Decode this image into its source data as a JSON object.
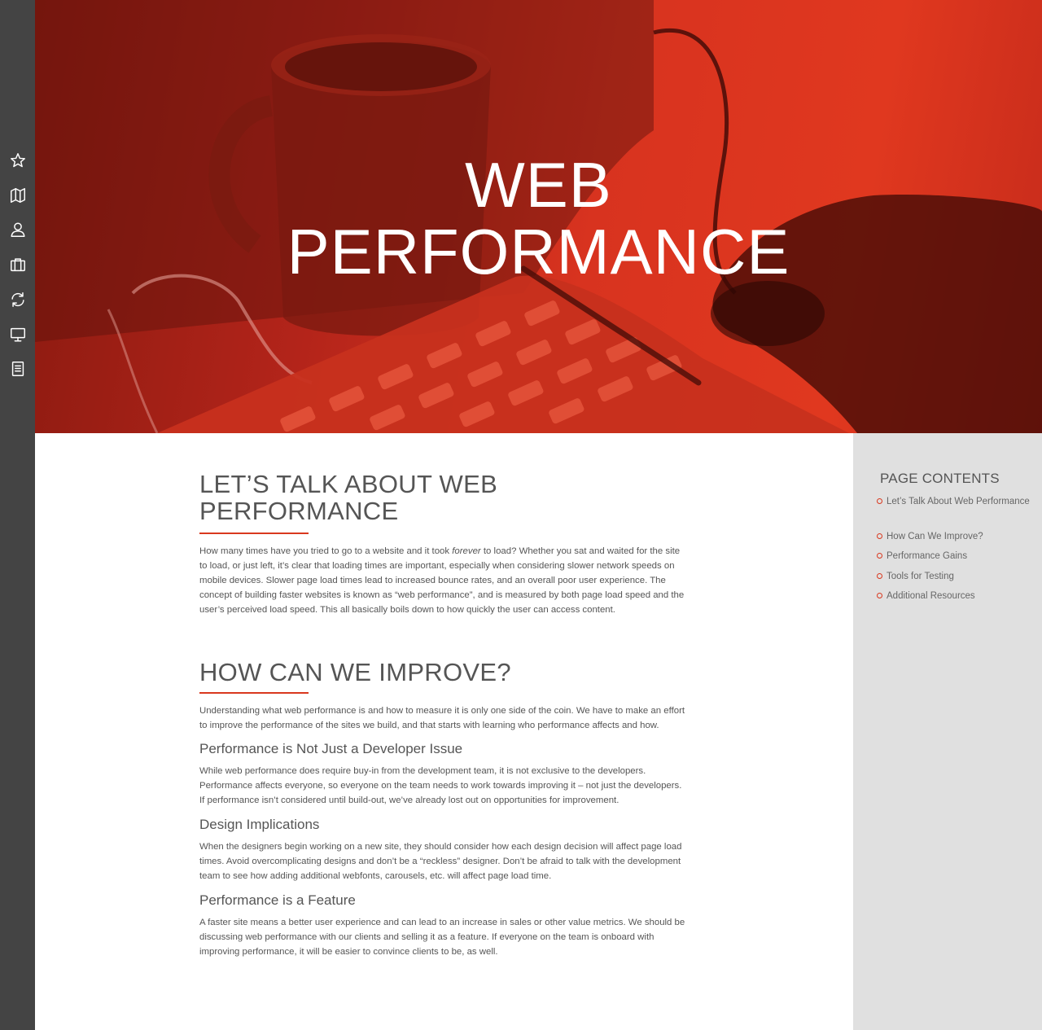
{
  "hero": {
    "title_line1": "WEB",
    "title_line2": "PERFORMANCE"
  },
  "rail": {
    "icons": [
      "star-icon",
      "map-icon",
      "user-icon",
      "briefcase-icon",
      "refresh-icon",
      "monitor-icon",
      "document-icon"
    ]
  },
  "article": {
    "section1": {
      "heading_line1": "LET’S TALK ABOUT WEB",
      "heading_line2": "PERFORMANCE",
      "para_before": "How many times have you tried to go to a website and it took ",
      "para_em": "forever",
      "para_after": " to load? Whether you sat and waited for the site to load, or just left, it’s clear that loading times are important, especially when considering slower network speeds on mobile devices. Slower page load times lead to increased bounce rates, and an overall poor user experience. The concept of building faster websites is known as “web performance”, and is measured by both page load speed and the user’s perceived load speed. This all basically boils down to how quickly the user can access content."
    },
    "section2": {
      "heading": "HOW CAN WE IMPROVE?",
      "intro": "Understanding what web performance is and how to measure it is only one side of the coin. We have to make an effort to improve the performance of the sites we build, and that starts with learning who performance affects and how.",
      "sub1_heading": "Performance is Not Just a Developer Issue",
      "sub1_para": "While web performance does require buy-in from the development team, it is not exclusive to the developers. Performance affects everyone, so everyone on the team needs to work towards improving it – not just the developers. If performance isn’t considered until build-out, we’ve already lost out on opportunities for improvement.",
      "sub2_heading": "Design Implications",
      "sub2_para": "When the designers begin working on a new site, they should consider how each design decision will affect page load times. Avoid overcomplicating designs and don’t be a “reckless” designer. Don’t be afraid to talk with the development team to see how adding additional webfonts, carousels, etc. will affect page load time.",
      "sub3_heading": "Performance is a Feature",
      "sub3_para": "A faster site means a better user experience and can lead to an increase in sales or other value metrics. We should be discussing web performance with our clients and selling it as a feature. If everyone on the team is onboard with improving performance, it will be easier to convince clients to be, as well."
    }
  },
  "toc": {
    "title": "PAGE CONTENTS",
    "items": [
      "Let’s Talk About Web Performance",
      "How Can We Improve?",
      "Performance Gains",
      "Tools for Testing",
      "Additional Resources"
    ]
  },
  "colors": {
    "accent": "#d9381e",
    "rail": "#444444",
    "sidebar": "#e0e0e0"
  }
}
